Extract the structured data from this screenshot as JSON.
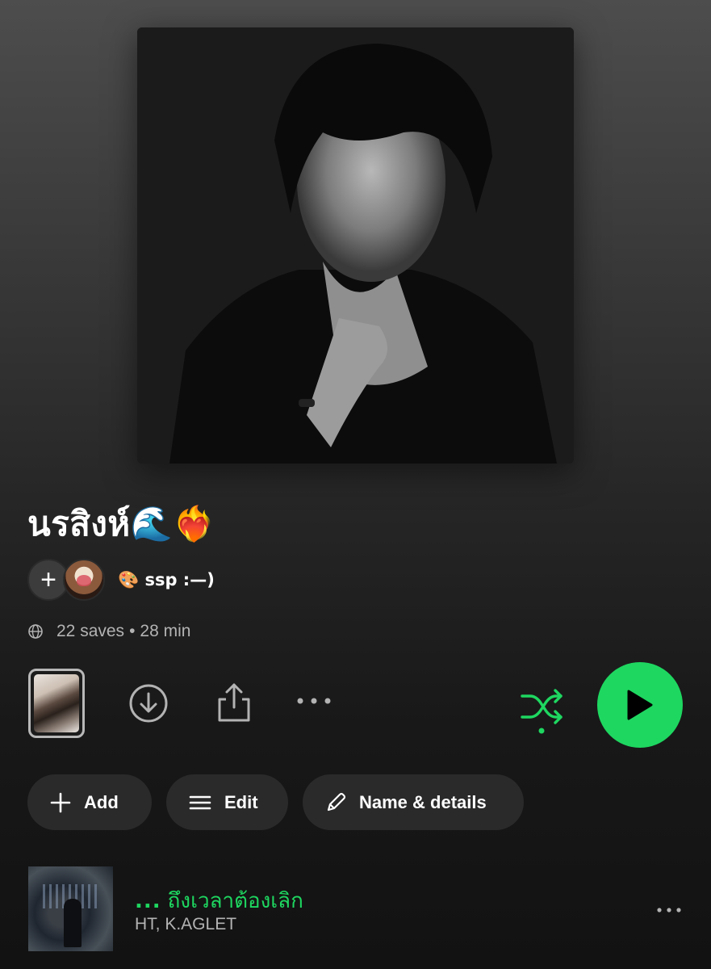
{
  "cover": {
    "icon": "playlist-cover-portrait"
  },
  "playlist": {
    "title": "นรสิงห์🌊❤️‍🔥",
    "owner": "🎨 ssp :—)",
    "saves": "22 saves",
    "separator": "•",
    "duration": "28 min"
  },
  "controls": {
    "add_collaborator": "+",
    "shuffle_active": true,
    "play_color": "#1ed760"
  },
  "chips": {
    "add": "Add",
    "edit": "Edit",
    "details": "Name & details"
  },
  "tracks": [
    {
      "prefix": "...",
      "title": "ถึงเวลาต้องเลิก",
      "artist": "HT, K.AGLET"
    }
  ],
  "colors": {
    "accent": "#1ed760",
    "muted": "#b3b3b3"
  }
}
